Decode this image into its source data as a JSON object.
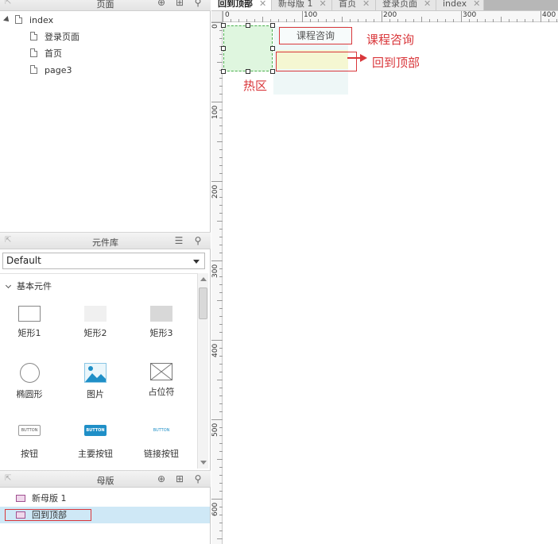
{
  "pages_panel": {
    "title": "页面",
    "tree": [
      {
        "label": "index",
        "level": 0,
        "expanded": true
      },
      {
        "label": "登录页面",
        "level": 1
      },
      {
        "label": "首页",
        "level": 1
      },
      {
        "label": "page3",
        "level": 1
      }
    ]
  },
  "library_panel": {
    "title": "元件库",
    "selected_library": "Default",
    "section_label": "基本元件",
    "widgets": [
      {
        "label": "矩形1",
        "icon": "rectangle-white-icon"
      },
      {
        "label": "矩形2",
        "icon": "rectangle-light-icon"
      },
      {
        "label": "矩形3",
        "icon": "rectangle-gray-icon"
      },
      {
        "label": "椭圆形",
        "icon": "ellipse-icon"
      },
      {
        "label": "图片",
        "icon": "image-icon"
      },
      {
        "label": "占位符",
        "icon": "placeholder-icon"
      },
      {
        "label": "按钮",
        "icon": "button-icon",
        "thumb_text": "BUTTON"
      },
      {
        "label": "主要按钮",
        "icon": "primary-button-icon",
        "thumb_text": "BUTTON"
      },
      {
        "label": "链接按钮",
        "icon": "link-button-icon",
        "thumb_text": "BUTTON"
      }
    ]
  },
  "masters_panel": {
    "title": "母版",
    "items": [
      {
        "label": "新母版 1",
        "selected": false
      },
      {
        "label": "回到顶部",
        "selected": true
      }
    ]
  },
  "editor": {
    "tabs": [
      {
        "label": "回到顶部",
        "active": true
      },
      {
        "label": "新母版 1",
        "active": false
      },
      {
        "label": "首页",
        "active": false
      },
      {
        "label": "登录页面",
        "active": false
      },
      {
        "label": "index",
        "active": false
      }
    ],
    "ruler_top_labels": [
      "0",
      "100",
      "200",
      "300",
      "400"
    ],
    "ruler_left_labels": [
      "0",
      "100",
      "200",
      "300",
      "400",
      "500",
      "600"
    ],
    "canvas": {
      "consult_box_text": "课程咨询",
      "annotation_consult": "课程咨询",
      "annotation_back_to_top": "回到顶部",
      "annotation_hotspot": "热区"
    }
  },
  "colors": {
    "annotation_red": "#d9373b",
    "hotspot_green_fill": "#dff6df",
    "hotspot_green_border": "#4caf50",
    "yellow_box_fill": "#f5f7d2",
    "master_selected_bg": "#cfe8f6",
    "primary_button_blue": "#1f8fc7"
  }
}
